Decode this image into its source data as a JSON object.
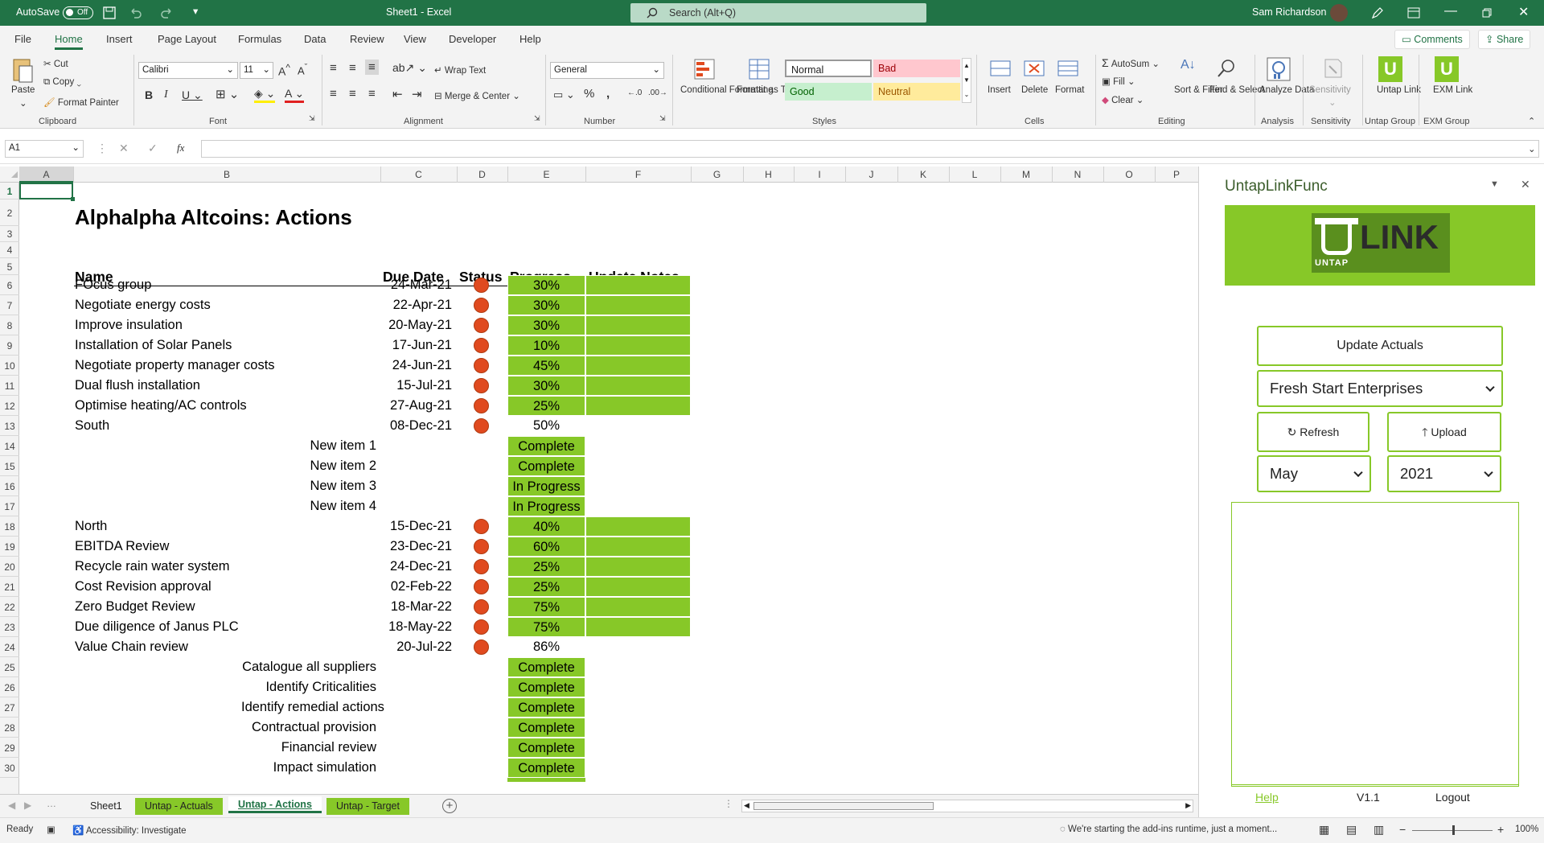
{
  "titlebar": {
    "autosave_label": "AutoSave",
    "autosave_state": "Off",
    "doc_title": "Sheet1  -  Excel",
    "search_placeholder": "Search (Alt+Q)",
    "user": "Sam Richardson"
  },
  "menu": {
    "tabs": [
      "File",
      "Home",
      "Insert",
      "Page Layout",
      "Formulas",
      "Data",
      "Review",
      "View",
      "Developer",
      "Help"
    ],
    "active": "Home",
    "comments": "Comments",
    "share": "Share"
  },
  "ribbon": {
    "clipboard": {
      "paste": "Paste",
      "cut": "Cut",
      "copy": "Copy",
      "format_painter": "Format Painter",
      "label": "Clipboard"
    },
    "font": {
      "name": "Calibri",
      "size": "11",
      "label": "Font"
    },
    "alignment": {
      "wrap": "Wrap Text",
      "merge": "Merge & Center",
      "label": "Alignment"
    },
    "number": {
      "format": "General",
      "label": "Number"
    },
    "styles": {
      "conditional": "Conditional Formatting",
      "format_table": "Format as Table",
      "normal": "Normal",
      "bad": "Bad",
      "good": "Good",
      "neutral": "Neutral",
      "label": "Styles"
    },
    "cells": {
      "insert": "Insert",
      "delete": "Delete",
      "format": "Format",
      "label": "Cells"
    },
    "editing": {
      "autosum": "AutoSum",
      "fill": "Fill",
      "clear": "Clear",
      "sort": "Sort & Filter",
      "find": "Find & Select",
      "label": "Editing"
    },
    "analysis": {
      "analyze": "Analyze Data",
      "label": "Analysis"
    },
    "sensitivity": {
      "btn": "Sensitivity",
      "label": "Sensitivity"
    },
    "untap": {
      "btn": "Untap Link",
      "label": "Untap Group"
    },
    "exm": {
      "btn": "EXM Link",
      "label": "EXM Group"
    }
  },
  "formula_bar": {
    "name_box": "A1",
    "formula": ""
  },
  "columns": [
    "A",
    "B",
    "C",
    "D",
    "E",
    "F",
    "G",
    "H",
    "I",
    "J",
    "K",
    "L",
    "M",
    "N",
    "O",
    "P"
  ],
  "sheet": {
    "title": "Alphalpha Altcoins: Actions",
    "headers": {
      "name": "Name",
      "due": "Due Date",
      "status": "Status",
      "progress": "Progress",
      "notes": "Update Notes"
    },
    "rows": [
      {
        "n": "6",
        "name": "FOcus group",
        "due": "24-Mar-21",
        "dot": true,
        "progress": "30%",
        "notes": true
      },
      {
        "n": "7",
        "name": "Negotiate energy costs",
        "due": "22-Apr-21",
        "dot": true,
        "progress": "30%",
        "notes": true
      },
      {
        "n": "8",
        "name": "Improve insulation",
        "due": "20-May-21",
        "dot": true,
        "progress": "30%",
        "notes": true
      },
      {
        "n": "9",
        "name": "Installation of Solar Panels",
        "due": "17-Jun-21",
        "dot": true,
        "progress": "10%",
        "notes": true
      },
      {
        "n": "10",
        "name": "Negotiate property manager costs",
        "due": "24-Jun-21",
        "dot": true,
        "progress": "45%",
        "notes": true
      },
      {
        "n": "11",
        "name": "Dual flush installation",
        "due": "15-Jul-21",
        "dot": true,
        "progress": "30%",
        "notes": true
      },
      {
        "n": "12",
        "name": "Optimise heating/AC controls",
        "due": "27-Aug-21",
        "dot": true,
        "progress": "25%",
        "notes": true
      },
      {
        "n": "13",
        "name": "South",
        "due": "08-Dec-21",
        "dot": true,
        "progress": "50%",
        "notes": false,
        "plain": true
      },
      {
        "n": "14",
        "sub": "New item 1",
        "progress": "Complete"
      },
      {
        "n": "15",
        "sub": "New item 2",
        "progress": "Complete"
      },
      {
        "n": "16",
        "sub": "New item 3",
        "progress": "In Progress"
      },
      {
        "n": "17",
        "sub": "New item 4",
        "progress": "In Progress"
      },
      {
        "n": "18",
        "name": "North",
        "due": "15-Dec-21",
        "dot": true,
        "progress": "40%",
        "notes": true
      },
      {
        "n": "19",
        "name": "EBITDA Review",
        "due": "23-Dec-21",
        "dot": true,
        "progress": "60%",
        "notes": true
      },
      {
        "n": "20",
        "name": "Recycle rain water system",
        "due": "24-Dec-21",
        "dot": true,
        "progress": "25%",
        "notes": true
      },
      {
        "n": "21",
        "name": "Cost Revision approval",
        "due": "02-Feb-22",
        "dot": true,
        "progress": "25%",
        "notes": true
      },
      {
        "n": "22",
        "name": "Zero Budget Review",
        "due": "18-Mar-22",
        "dot": true,
        "progress": "75%",
        "notes": true
      },
      {
        "n": "23",
        "name": "Due diligence of Janus PLC",
        "due": "18-May-22",
        "dot": true,
        "progress": "75%",
        "notes": true
      },
      {
        "n": "24",
        "name": "Value Chain review",
        "due": "20-Jul-22",
        "dot": true,
        "progress": "86%",
        "notes": false,
        "plain": true
      },
      {
        "n": "25",
        "sub": "Catalogue all suppliers",
        "progress": "Complete"
      },
      {
        "n": "26",
        "sub": "Identify Criticalities",
        "progress": "Complete"
      },
      {
        "n": "27",
        "sub": "Identify remedial actions",
        "progress": "Complete"
      },
      {
        "n": "28",
        "sub": "Contractual provision",
        "progress": "Complete"
      },
      {
        "n": "29",
        "sub": "Financial review",
        "progress": "Complete"
      },
      {
        "n": "30",
        "sub": "Impact simulation",
        "progress": "Complete"
      }
    ]
  },
  "sheet_tabs": [
    {
      "name": "Sheet1",
      "style": "plain"
    },
    {
      "name": "Untap - Actuals",
      "style": "green"
    },
    {
      "name": "Untap - Actions",
      "style": "active"
    },
    {
      "name": "Untap - Target",
      "style": "green"
    }
  ],
  "status": {
    "ready": "Ready",
    "accessibility": "Accessibility: Investigate",
    "message": "We're starting the add-ins runtime, just a moment...",
    "zoom": "100%"
  },
  "pane": {
    "title": "UntapLinkFunc",
    "logo_text": "LINK",
    "logo_sub": "UNTAP",
    "update_actuals": "Update Actuals",
    "company": "Fresh Start Enterprises",
    "refresh": "Refresh",
    "upload": "Upload",
    "month": "May",
    "year": "2021",
    "help": "Help",
    "version": "V1.1",
    "logout": "Logout"
  },
  "colors": {
    "excel_green": "#217346",
    "progress_green": "#87c828",
    "status_red": "#e04a1f"
  }
}
